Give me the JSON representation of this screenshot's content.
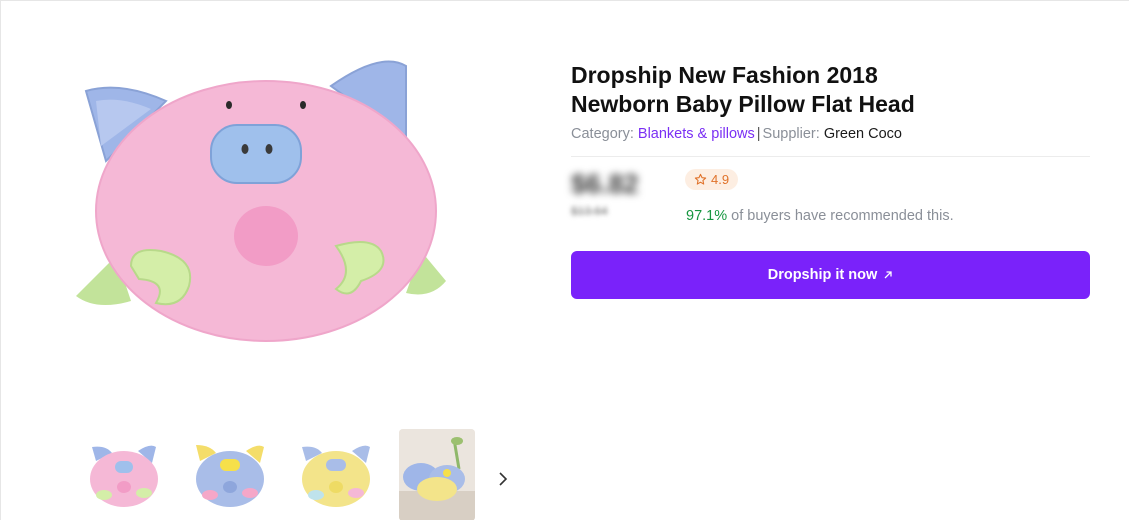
{
  "product": {
    "title_line1": "Dropship New Fashion 2018",
    "title_line2": "Newborn Baby Pillow Flat Head",
    "category_label": "Category:",
    "category_value": "Blankets & pillows",
    "separator": "|",
    "supplier_label": "Supplier:",
    "supplier_value": "Green Coco",
    "price": "$6.82",
    "old_price": "$13.64",
    "rating": "4.9",
    "recommend_pct": "97.1%",
    "recommend_text": "of buyers have recommended this.",
    "cta_label": "Dropship it now",
    "cta_icon": "arrow-up-right-icon"
  },
  "gallery": {
    "thumbnails": [
      "pink pig pillow",
      "blue pig pillow",
      "yellow pig pillow",
      "pillows photo"
    ],
    "next_icon": "chevron-right-icon"
  },
  "colors": {
    "accent": "#7a22fa",
    "link": "#7a2ff4",
    "success": "#15963f",
    "rating_bg": "#fdeee2",
    "rating_fg": "#e0722a"
  }
}
